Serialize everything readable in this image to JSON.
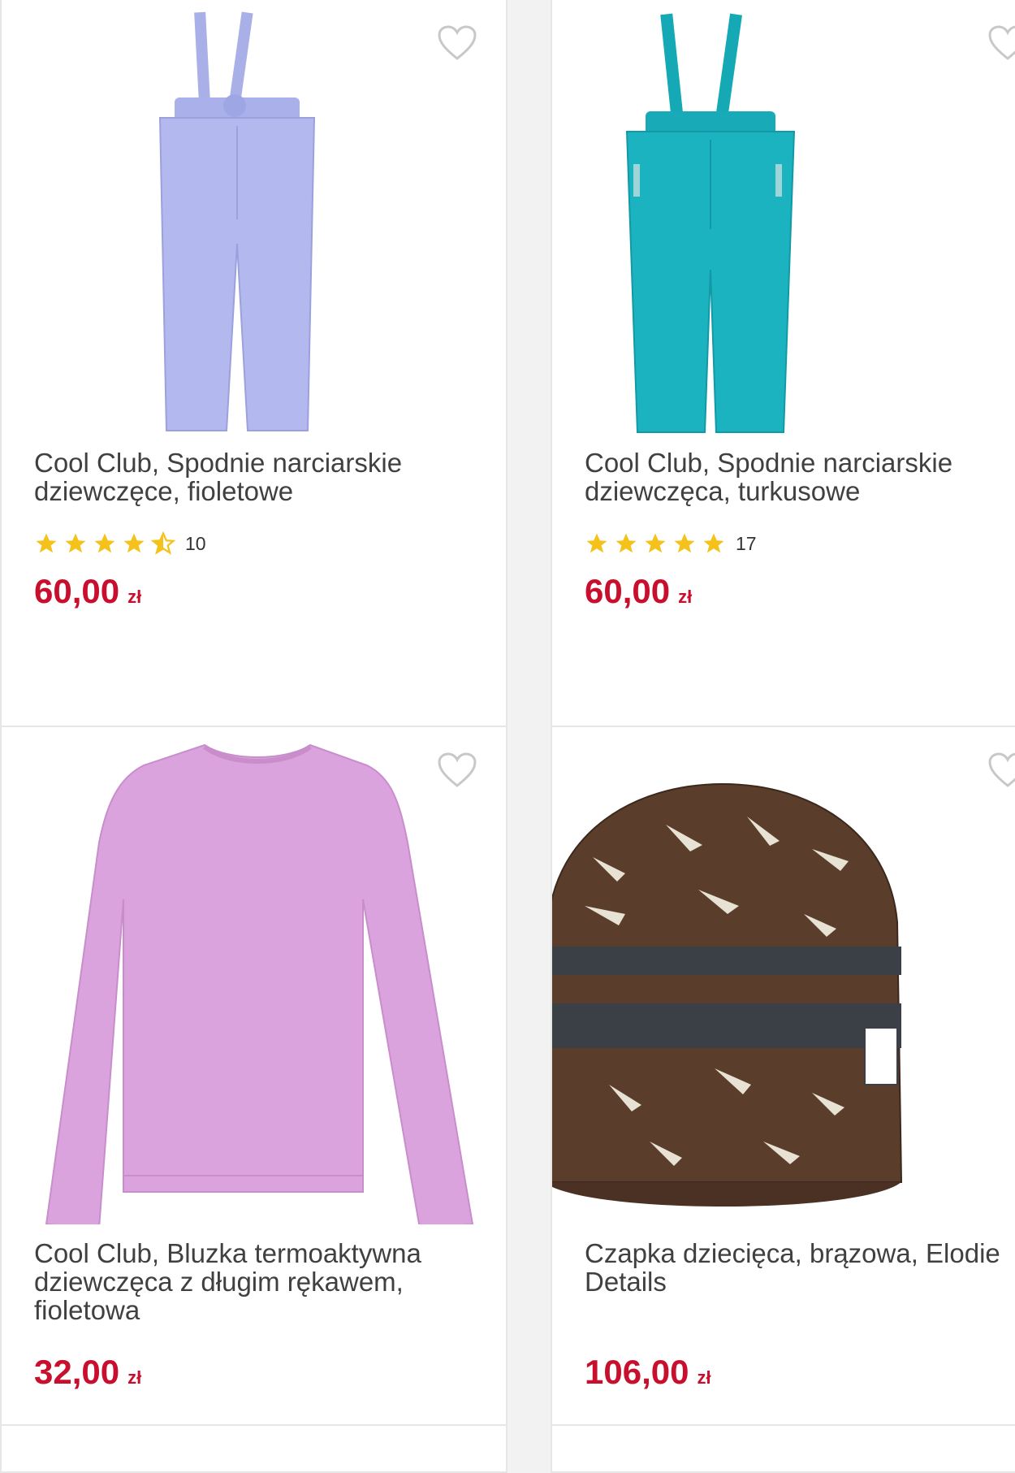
{
  "accent_color": "#c8102e",
  "star_color": "#f5c21b",
  "products": [
    {
      "title": "Cool Club, Spodnie narciarskie dziewczęce, fioletowe",
      "rating": 4.5,
      "review_count": "10",
      "price": "60,00",
      "currency": "zł",
      "image_icon": "ski-pants-lilac"
    },
    {
      "title": "Cool Club, Spodnie narciarskie dziewczęca, turkusowe",
      "rating": 5,
      "review_count": "17",
      "price": "60,00",
      "currency": "zł",
      "image_icon": "ski-pants-turquoise"
    },
    {
      "title": "Cool Club, Bluzka termoaktywna dziewczęca z długim rękawem, fioletowa",
      "price": "32,00",
      "currency": "zł",
      "image_icon": "long-sleeve-top-pink"
    },
    {
      "title": "Czapka dziecięca, brązowa, Elodie Details",
      "price": "106,00",
      "currency": "zł",
      "image_icon": "beanie-brown"
    }
  ]
}
